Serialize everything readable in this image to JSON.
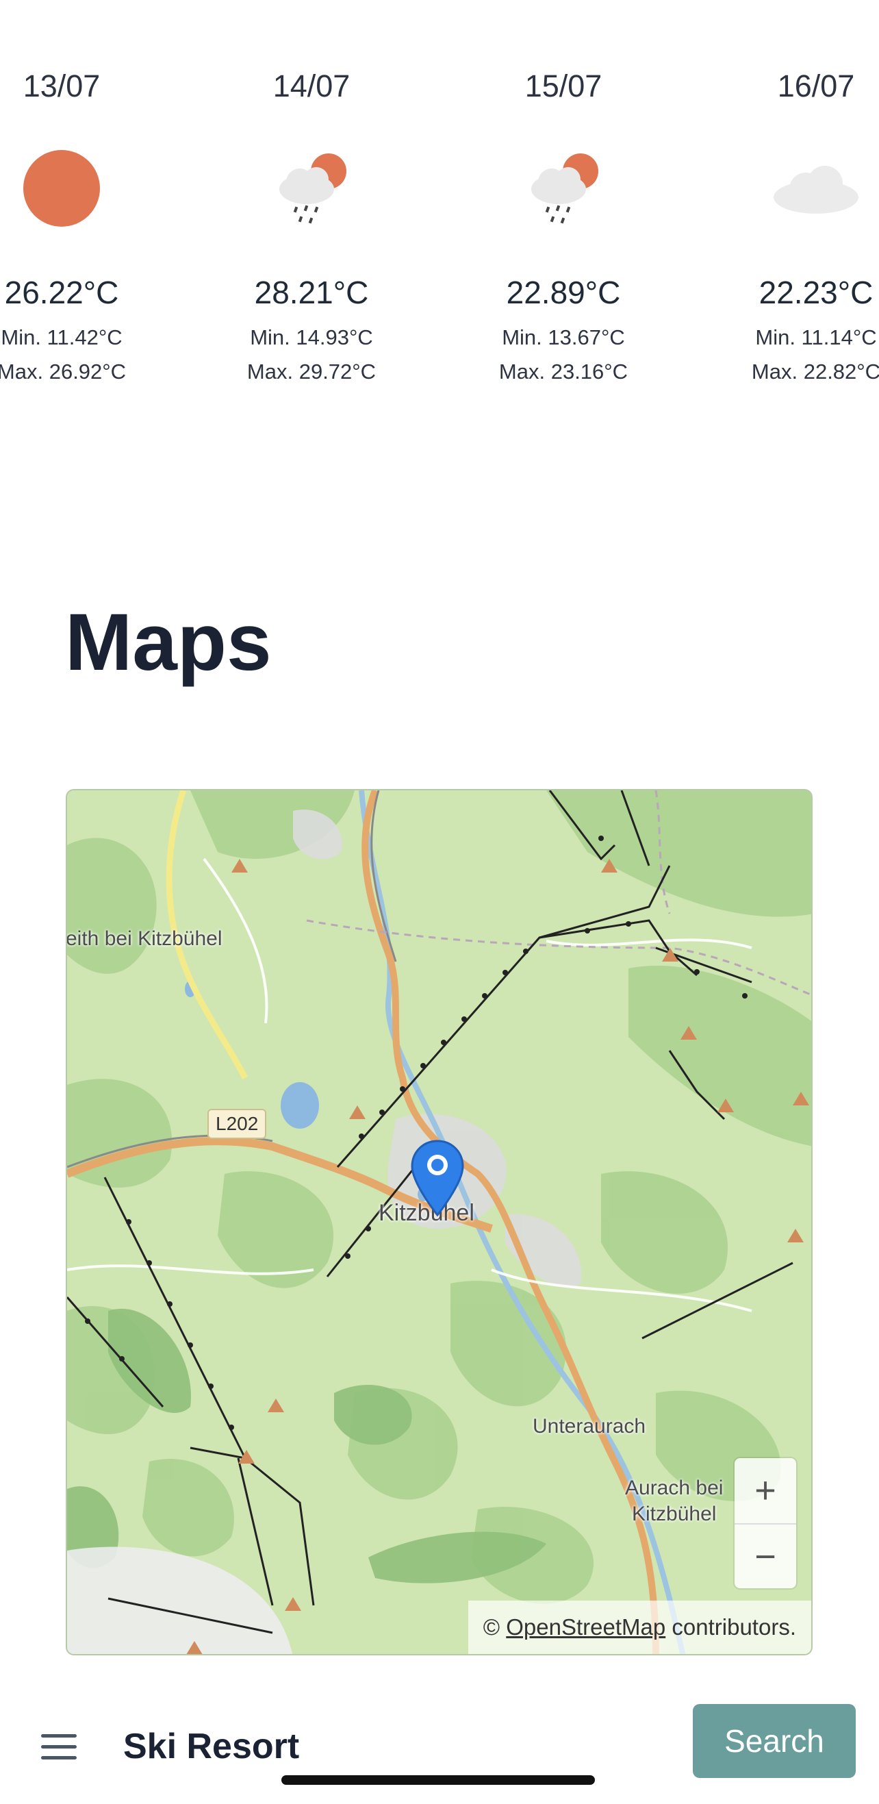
{
  "weather": {
    "days": [
      {
        "date": "13/07",
        "icon": "sun-icon",
        "temp": "26.22°C",
        "min": "Min. 11.42°C",
        "max": "Max. 26.92°C"
      },
      {
        "date": "14/07",
        "icon": "rain-sun-icon",
        "temp": "28.21°C",
        "min": "Min. 14.93°C",
        "max": "Max. 29.72°C"
      },
      {
        "date": "15/07",
        "icon": "rain-sun-icon",
        "temp": "22.89°C",
        "min": "Min. 13.67°C",
        "max": "Max. 23.16°C"
      },
      {
        "date": "16/07",
        "icon": "cloud-icon",
        "temp": "22.23°C",
        "min": "Min. 11.14°C",
        "max": "Max. 22.82°C"
      }
    ]
  },
  "maps": {
    "title": "Maps",
    "labels": {
      "town": "Kitzbühel",
      "village_left": "eith bei Kitzbühel",
      "unteraurach": "Unteraurach",
      "aurach_line1": "Aurach bei",
      "aurach_line2": "Kitzbühel",
      "road": "L202"
    },
    "zoom_in": "+",
    "zoom_out": "−",
    "attribution_prefix": "©",
    "attribution_link": "OpenStreetMap",
    "attribution_suffix": "contributors."
  },
  "bottom_bar": {
    "brand": "Ski Resort",
    "search_label": "Search"
  },
  "colors": {
    "sun": "#e07551",
    "accent": "#6a9e9c",
    "marker": "#2f7fe8"
  }
}
